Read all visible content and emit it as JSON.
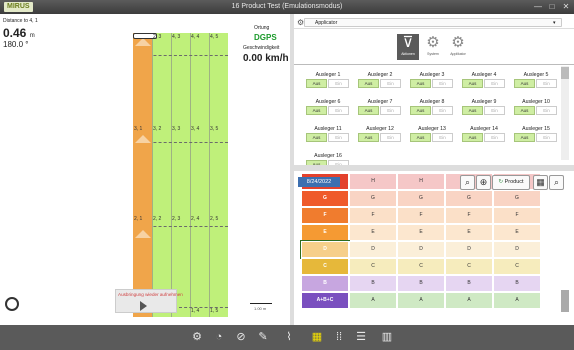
{
  "title_bar": {
    "logo": "MIRUS",
    "title": "16 Product Test (Emulationsmodus)",
    "minimize": "—",
    "maximize": "□",
    "close": "✕"
  },
  "field": {
    "distance_label": "Distance to 4, 1",
    "distance_value": "0.46",
    "distance_unit": "m",
    "heading": "180.0 °",
    "ortung_label": "Ortung",
    "ortung_value": "DGPS",
    "speed_label": "Geschwindigkeit",
    "speed_value": "0.00 km/h",
    "resume_text": "Ausbringung wieder aufnehmen",
    "scale_text": "1.00 m",
    "row_labels_top": [
      "2, 3",
      "4, 3",
      "4, 4",
      "4, 5"
    ],
    "row_labels_mid": [
      "3, 1",
      "3, 2",
      "3, 3",
      "3, 4",
      "3, 5"
    ],
    "row_labels_low": [
      "2, 1",
      "2, 2",
      "2, 3",
      "2, 4",
      "2, 5"
    ],
    "row_labels_bottom": [
      "1, 4",
      "1, 5"
    ]
  },
  "applicator": {
    "selected": "Applicator",
    "tabs": [
      {
        "label": "Aktionen",
        "icon": "boom-icon"
      },
      {
        "label": "System",
        "icon": "gears-icon"
      },
      {
        "label": "Applikator",
        "icon": "gears-icon"
      }
    ],
    "on_label": "Aus",
    "off_label": "Ein",
    "booms": [
      "Ausleger 1",
      "Ausleger 2",
      "Ausleger 3",
      "Ausleger 4",
      "Ausleger 5",
      "Ausleger 6",
      "Ausleger 7",
      "Ausleger 8",
      "Ausleger 9",
      "Ausleger 10",
      "Ausleger 11",
      "Ausleger 12",
      "Ausleger 13",
      "Ausleger 14",
      "Ausleger 15",
      "Ausleger 16"
    ]
  },
  "grid": {
    "date": "8/24/2022",
    "product_label": "Product",
    "rows": [
      {
        "label": "H",
        "label_color": "#e3412c",
        "color": "#f5c7c7",
        "cells": [
          "H",
          "H",
          "H",
          "H"
        ]
      },
      {
        "label": "G",
        "label_color": "#ef5a2a",
        "color": "#f9d4c4",
        "cells": [
          "G",
          "G",
          "G",
          "G"
        ]
      },
      {
        "label": "F",
        "label_color": "#f07c2e",
        "color": "#fbe0c8",
        "cells": [
          "F",
          "F",
          "F",
          "F"
        ]
      },
      {
        "label": "E",
        "label_color": "#f59a33",
        "color": "#fce7cf",
        "cells": [
          "E",
          "E",
          "E",
          "E"
        ]
      },
      {
        "label": "D",
        "label_color": "#f6cf8a",
        "color": "#fbefd9",
        "cells": [
          "D",
          "D",
          "D",
          "D"
        ]
      },
      {
        "label": "C",
        "label_color": "#e6b83a",
        "color": "#f6ecbd",
        "cells": [
          "C",
          "C",
          "C",
          "C"
        ]
      },
      {
        "label": "B",
        "label_color": "#c7a6e0",
        "color": "#e6d6f2",
        "cells": [
          "B",
          "B",
          "B",
          "B"
        ]
      },
      {
        "label": "A+B+C",
        "label_color": "#7a4fbf",
        "color": "#cfe9c4",
        "cells": [
          "A",
          "A",
          "A",
          "A"
        ]
      }
    ]
  },
  "toolbar": {
    "icons": [
      "gear-target-icon",
      "pie-icon",
      "compass-icon",
      "pencil-icon",
      "chart-icon",
      "tiles-icon",
      "grid-dots-icon",
      "list-icon",
      "table-icon"
    ]
  }
}
